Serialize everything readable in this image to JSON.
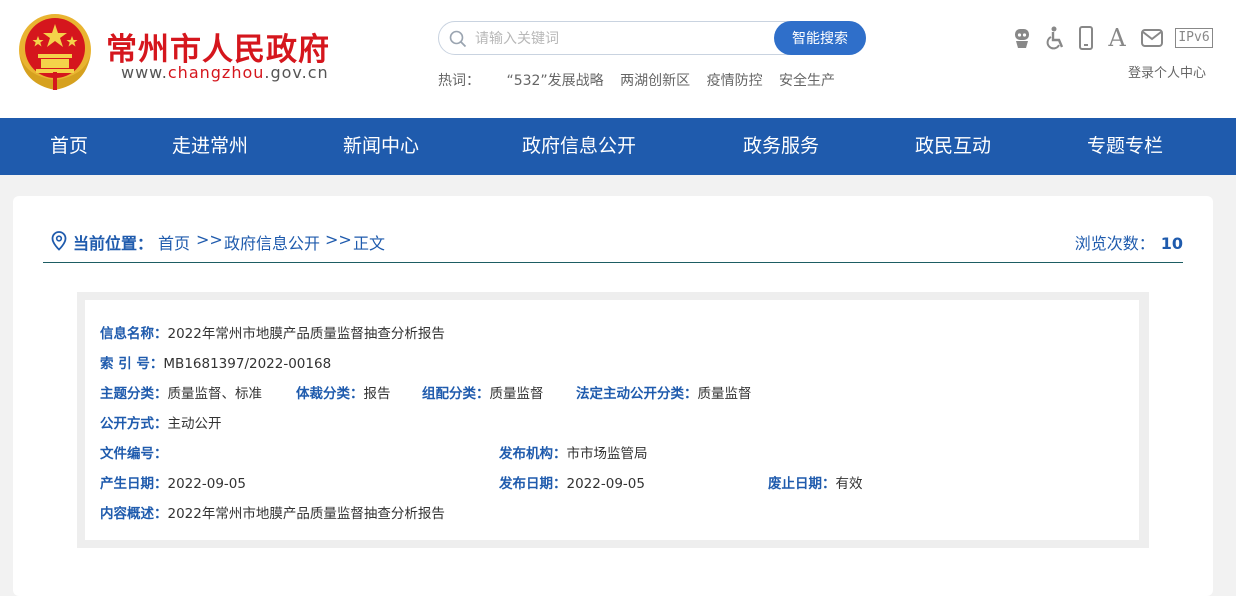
{
  "header": {
    "title": "常州市人民政府",
    "url_prefix": "www.",
    "url_domain": "changzhou",
    "url_suffix": ".gov.cn",
    "brand_red": "#d5161d",
    "brand_blue": "#1f5bad"
  },
  "search": {
    "placeholder": "请输入关键词",
    "button_label": "智能搜索",
    "hot_label": "热词：",
    "hot_words": [
      "“532”发展战略",
      "两湖创新区",
      "疫情防控",
      "安全生产"
    ]
  },
  "tools": {
    "icons": [
      "robot-icon",
      "accessibility-icon",
      "mobile-icon",
      "font-size-icon",
      "mail-icon",
      "ipv6-icon"
    ],
    "font_glyph": "A",
    "ipv6_label": "IPv6",
    "login_label": "登录个人中心"
  },
  "nav": {
    "items": [
      "首页",
      "走进常州",
      "新闻中心",
      "政府信息公开",
      "政务服务",
      "政民互动",
      "专题专栏"
    ]
  },
  "breadcrumb": {
    "label": "当前位置：",
    "items": [
      "首页",
      "政府信息公开",
      "正文"
    ],
    "separator": ">>",
    "views_label": "浏览次数：",
    "views_count": "10"
  },
  "info": {
    "name_label": "信息名称：",
    "name_value": "2022年常州市地膜产品质量监督抽查分析报告",
    "index_label": "索 引 号：",
    "index_value": "MB1681397/2022-00168",
    "topic_label": "主题分类：",
    "topic_value": "质量监督、标准",
    "genre_label": "体裁分类：",
    "genre_value": "报告",
    "org_label": "组配分类：",
    "org_value": "质量监督",
    "legal_label": "法定主动公开分类：",
    "legal_value": "质量监督",
    "mode_label": "公开方式：",
    "mode_value": "主动公开",
    "docno_label": "文件编号：",
    "docno_value": "",
    "issuer_label": "发布机构：",
    "issuer_value": "市市场监管局",
    "created_label": "产生日期：",
    "created_value": "2022-09-05",
    "published_label": "发布日期：",
    "published_value": "2022-09-05",
    "expiry_label": "废止日期：",
    "expiry_value": "有效",
    "summary_label": "内容概述：",
    "summary_value": "2022年常州市地膜产品质量监督抽查分析报告"
  }
}
